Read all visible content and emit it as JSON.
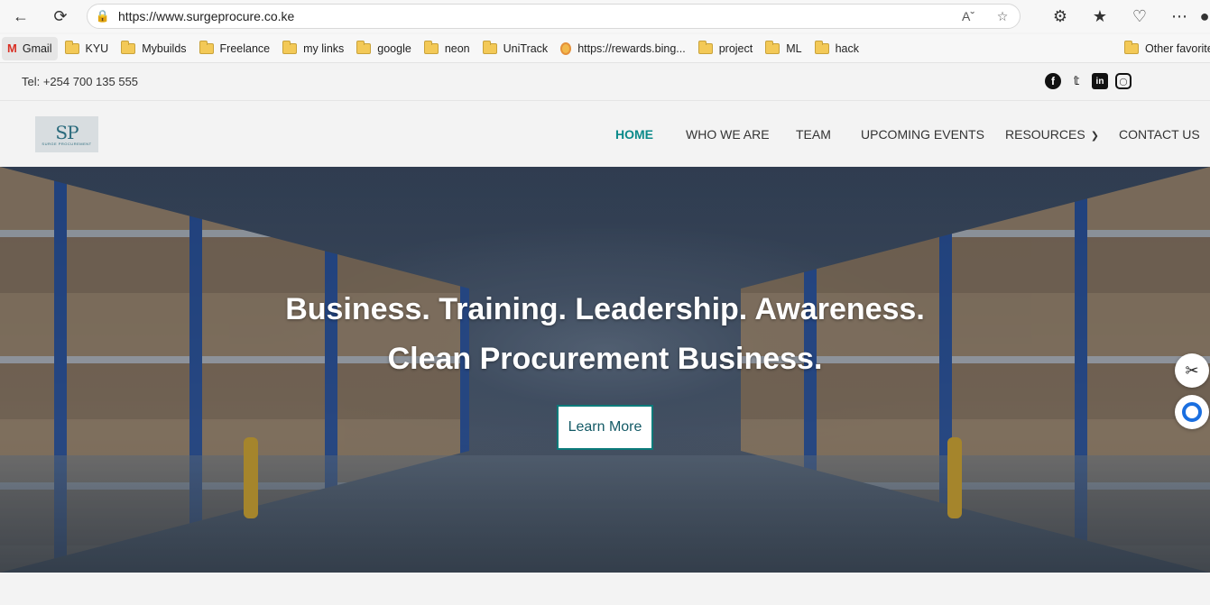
{
  "browser": {
    "url": "https://www.surgeprocure.co.ke",
    "bookmarks": [
      "Gmail",
      "KYU",
      "Mybuilds",
      "Freelance",
      "my links",
      "google",
      "neon",
      "UniTrack",
      "https://rewards.bing...",
      "project",
      "ML",
      "hack"
    ],
    "other_favorites": "Other favorite"
  },
  "topbar": {
    "tel": "Tel: +254 700 135 555",
    "social": [
      "facebook-icon",
      "twitter-icon",
      "linkedin-icon",
      "instagram-icon"
    ]
  },
  "nav": {
    "logo_text": "SP",
    "logo_sub": "SURGE PROCUREMENT",
    "items": [
      "HOME",
      "WHO WE ARE",
      "TEAM",
      "UPCOMING EVENTS",
      "RESOURCES",
      "CONTACT US"
    ],
    "active_color": "#0b8a8a"
  },
  "hero": {
    "line1": "Business. Training. Leadership. Awareness.",
    "line2": "Clean Procurement Business.",
    "cta": "Learn More"
  },
  "colors": {
    "accent": "#0b8a8a",
    "button_border": "#0b7a7a"
  }
}
